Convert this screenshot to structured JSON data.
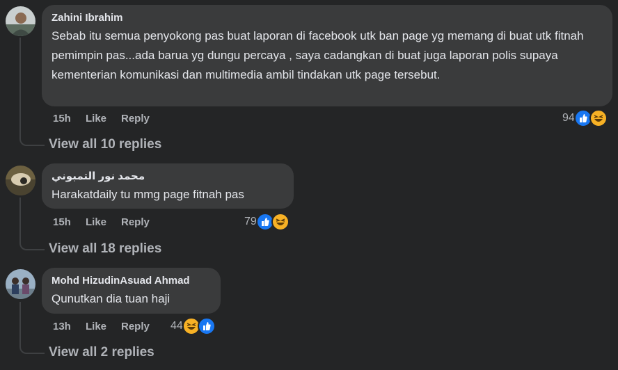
{
  "comments": [
    {
      "author": "Zahini Ibrahim",
      "text": "Sebab itu semua penyokong pas buat laporan di facebook utk ban page yg memang di buat utk fitnah pemimpin pas...ada barua yg dungu percaya , saya cadangkan di buat juga laporan polis supaya kementerian komunikasi dan multimedia ambil tindakan utk page tersebut.",
      "time": "15h",
      "like_label": "Like",
      "reply_label": "Reply",
      "reaction_count": "94",
      "reactions": [
        "like-icon",
        "haha-icon"
      ],
      "view_replies": "View all 10 replies"
    },
    {
      "author": "محمد نور التمبوني",
      "text": "Harakatdaily tu mmg page fitnah pas",
      "time": "15h",
      "like_label": "Like",
      "reply_label": "Reply",
      "reaction_count": "79",
      "reactions": [
        "like-icon",
        "haha-icon"
      ],
      "view_replies": "View all 18 replies"
    },
    {
      "author": "Mohd HizudinAsuad Ahmad",
      "text": "Qunutkan dia tuan haji",
      "time": "13h",
      "like_label": "Like",
      "reply_label": "Reply",
      "reaction_count": "44",
      "reactions": [
        "haha-icon",
        "like-icon"
      ],
      "view_replies": "View all 2 replies"
    }
  ],
  "colors": {
    "background": "#242526",
    "bubble": "#3a3b3c",
    "primary_text": "#e4e6eb",
    "secondary_text": "#b0b3b8",
    "like_blue": "#1877f2",
    "haha_yellow": "#f7b125"
  }
}
